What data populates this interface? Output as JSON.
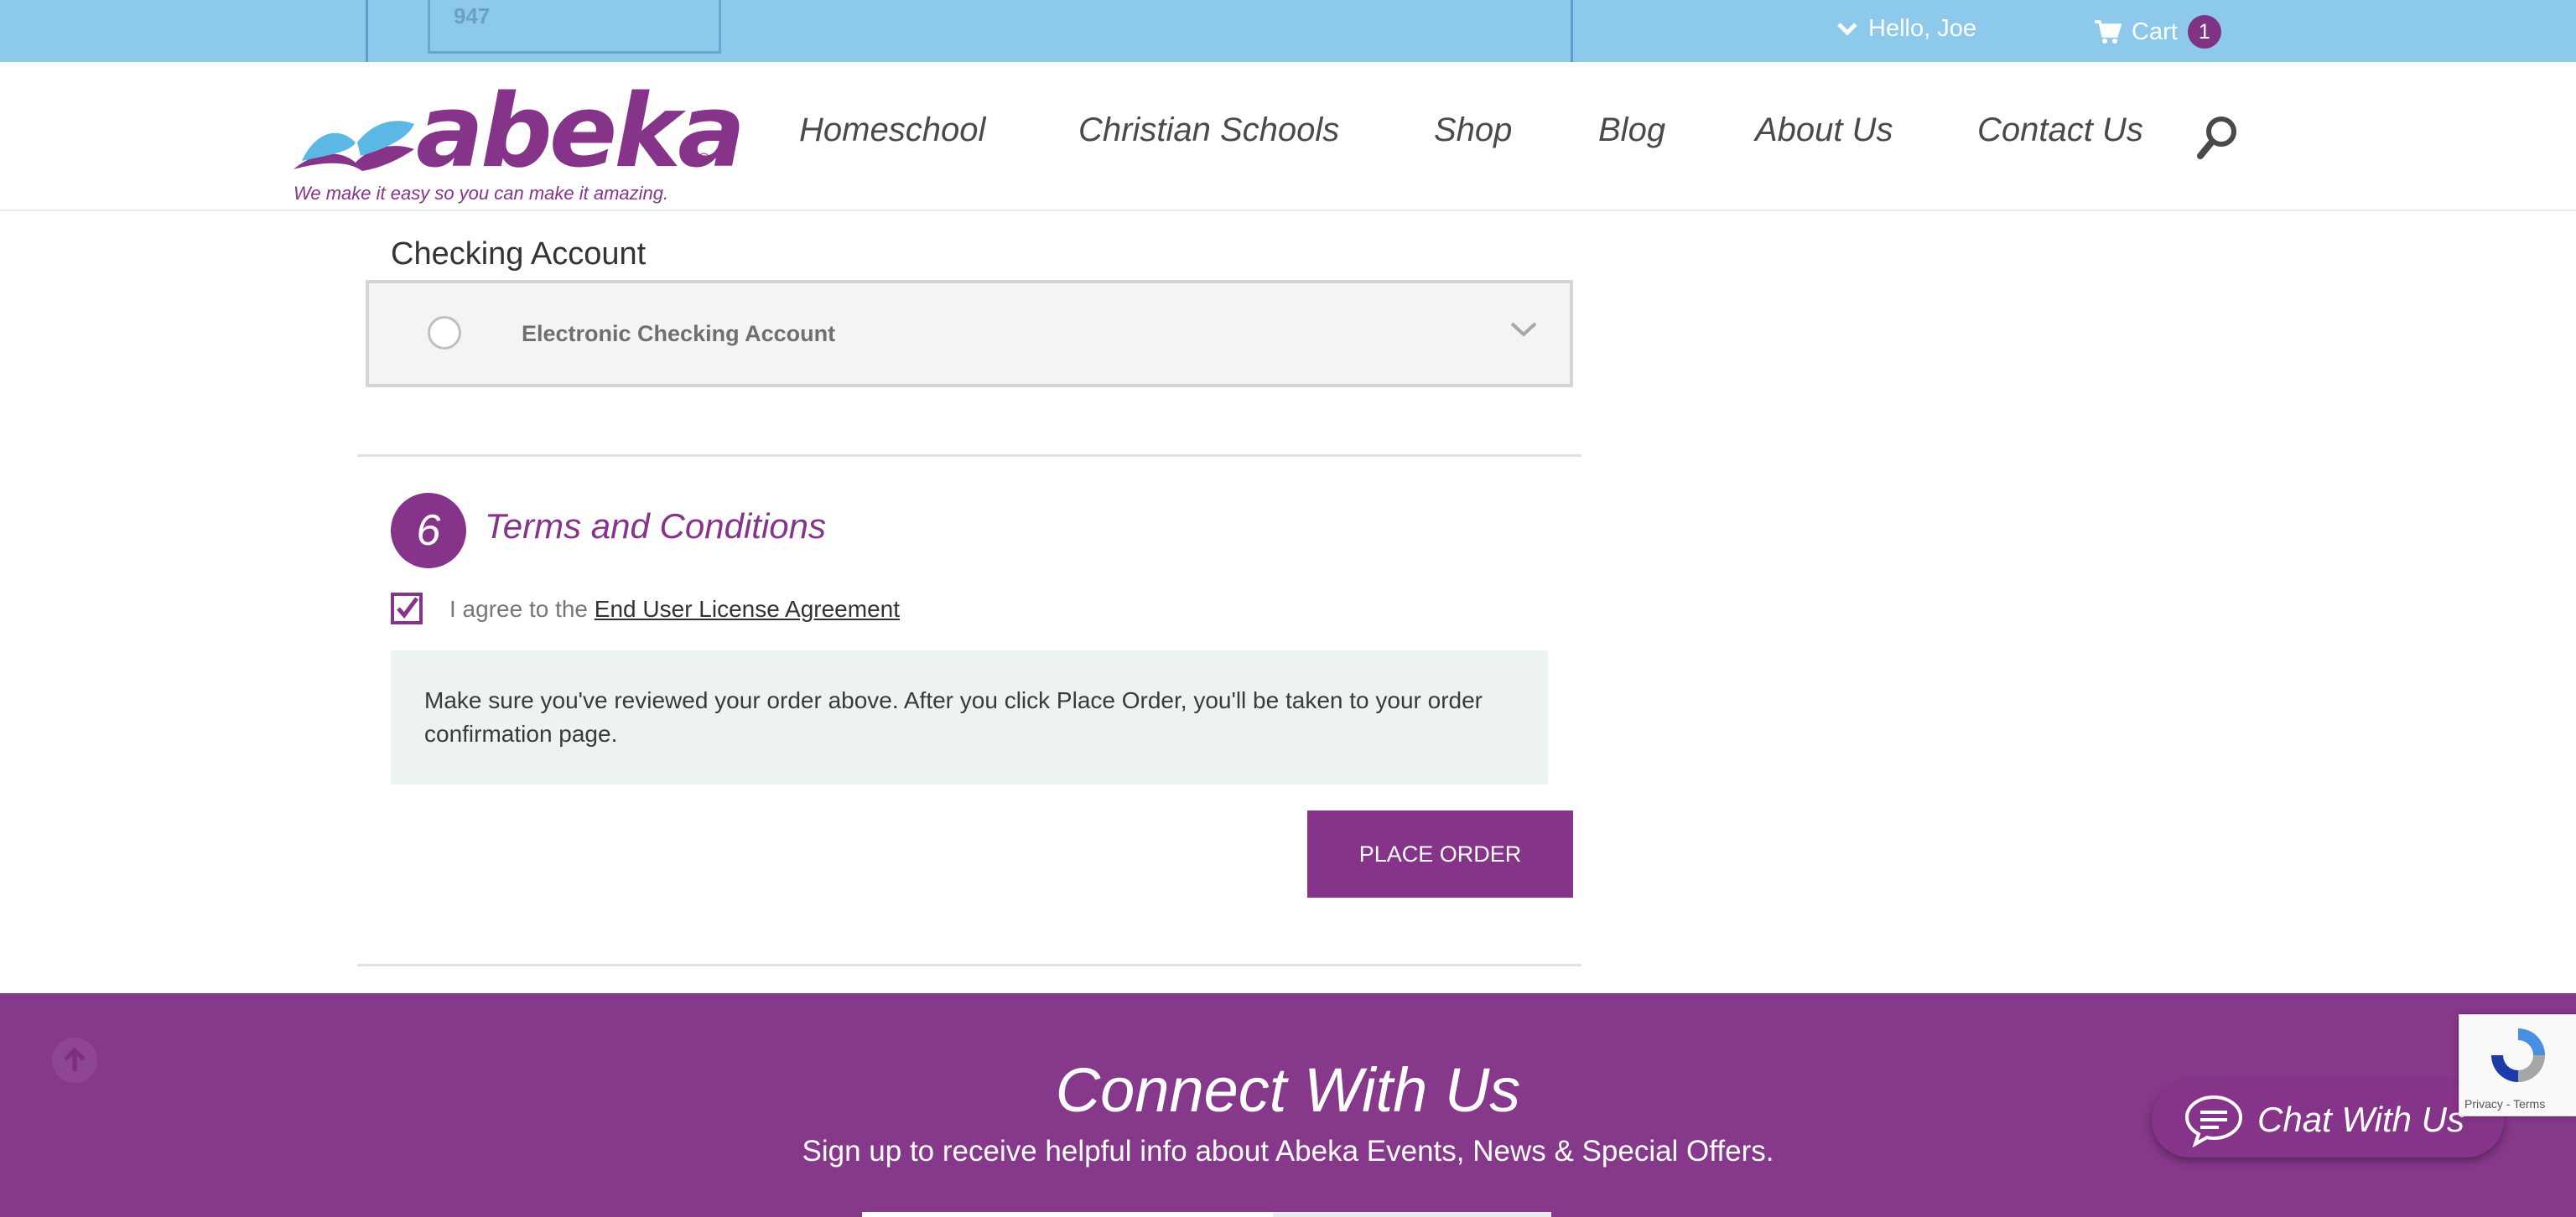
{
  "topbar": {
    "partial_field_value": "947",
    "greeting": "Hello, Joe",
    "cart_label": "Cart",
    "cart_count": "1"
  },
  "header": {
    "logo_word": "abeka",
    "logo_reg": "®",
    "tagline": "We make it easy so you can make it amazing.",
    "nav": [
      "Homeschool",
      "Christian Schools",
      "Shop",
      "Blog",
      "About Us",
      "Contact Us"
    ]
  },
  "payment": {
    "section_title": "Checking Account",
    "option_label": "Electronic Checking Account",
    "option_selected": false
  },
  "terms": {
    "step_number": "6",
    "title": "Terms and Conditions",
    "agree_prefix": "I agree to the",
    "eula_link": "End User License Agreement",
    "agreed": true,
    "notice": "Make sure you've reviewed your order above. After you click Place Order, you'll be taken to your order confirmation page.",
    "place_order_label": "PLACE ORDER"
  },
  "footer": {
    "title": "Connect With Us",
    "subtitle": "Sign up to receive helpful info about Abeka Events, News & Special Offers."
  },
  "chat": {
    "label": "Chat With Us"
  },
  "recaptcha": {
    "text": "Privacy - Terms"
  },
  "colors": {
    "brand_purple": "#86348a",
    "topbar_blue": "#8cc9ea"
  }
}
